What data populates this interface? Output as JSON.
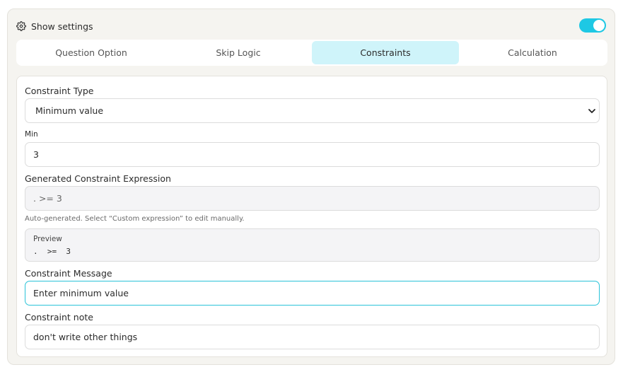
{
  "header": {
    "title": "Show settings",
    "icon": "gear-icon",
    "toggle_on": true,
    "accent_color": "#1ec8e4"
  },
  "tabs": [
    {
      "label": "Question Option",
      "active": false
    },
    {
      "label": "Skip Logic",
      "active": false
    },
    {
      "label": "Constraints",
      "active": true
    },
    {
      "label": "Calculation",
      "active": false
    }
  ],
  "constraints": {
    "type_label": "Constraint Type",
    "type_value": "Minimum value",
    "min_label": "Min",
    "min_value": "3",
    "expression_label": "Generated Constraint Expression",
    "expression_value": ". >= 3",
    "hint": "Auto-generated. Select “Custom expression” to edit manually.",
    "preview_label": "Preview",
    "preview_value": ".  >=  3",
    "message_label": "Constraint Message",
    "message_value": "Enter minimum value",
    "note_label": "Constraint note",
    "note_value": "don't write other things"
  }
}
